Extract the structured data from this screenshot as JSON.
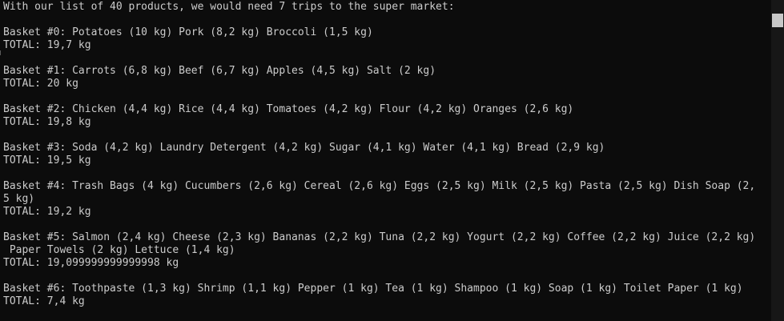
{
  "console": {
    "lines": [
      "With our list of 40 products, we would need 7 trips to the super market:",
      "",
      "Basket #0: Potatoes (10 kg) Pork (8,2 kg) Broccoli (1,5 kg)",
      "TOTAL: 19,7 kg",
      "",
      "Basket #1: Carrots (6,8 kg) Beef (6,7 kg) Apples (4,5 kg) Salt (2 kg)",
      "TOTAL: 20 kg",
      "",
      "Basket #2: Chicken (4,4 kg) Rice (4,4 kg) Tomatoes (4,2 kg) Flour (4,2 kg) Oranges (2,6 kg)",
      "TOTAL: 19,8 kg",
      "",
      "Basket #3: Soda (4,2 kg) Laundry Detergent (4,2 kg) Sugar (4,1 kg) Water (4,1 kg) Bread (2,9 kg)",
      "TOTAL: 19,5 kg",
      "",
      "Basket #4: Trash Bags (4 kg) Cucumbers (2,6 kg) Cereal (2,6 kg) Eggs (2,5 kg) Milk (2,5 kg) Pasta (2,5 kg) Dish Soap (2,",
      "5 kg)",
      "TOTAL: 19,2 kg",
      "",
      "Basket #5: Salmon (2,4 kg) Cheese (2,3 kg) Bananas (2,2 kg) Tuna (2,2 kg) Yogurt (2,2 kg) Coffee (2,2 kg) Juice (2,2 kg)",
      " Paper Towels (2 kg) Lettuce (1,4 kg)",
      "TOTAL: 19,099999999999998 kg",
      "",
      "Basket #6: Toothpaste (1,3 kg) Shrimp (1,1 kg) Pepper (1 kg) Tea (1 kg) Shampoo (1 kg) Soap (1 kg) Toilet Paper (1 kg)",
      "TOTAL: 7,4 kg"
    ]
  },
  "colors": {
    "background": "#0c0c0c",
    "text": "#cccccc",
    "scrollbar_track": "#171717",
    "scrollbar_thumb": "#c8c8c8"
  }
}
